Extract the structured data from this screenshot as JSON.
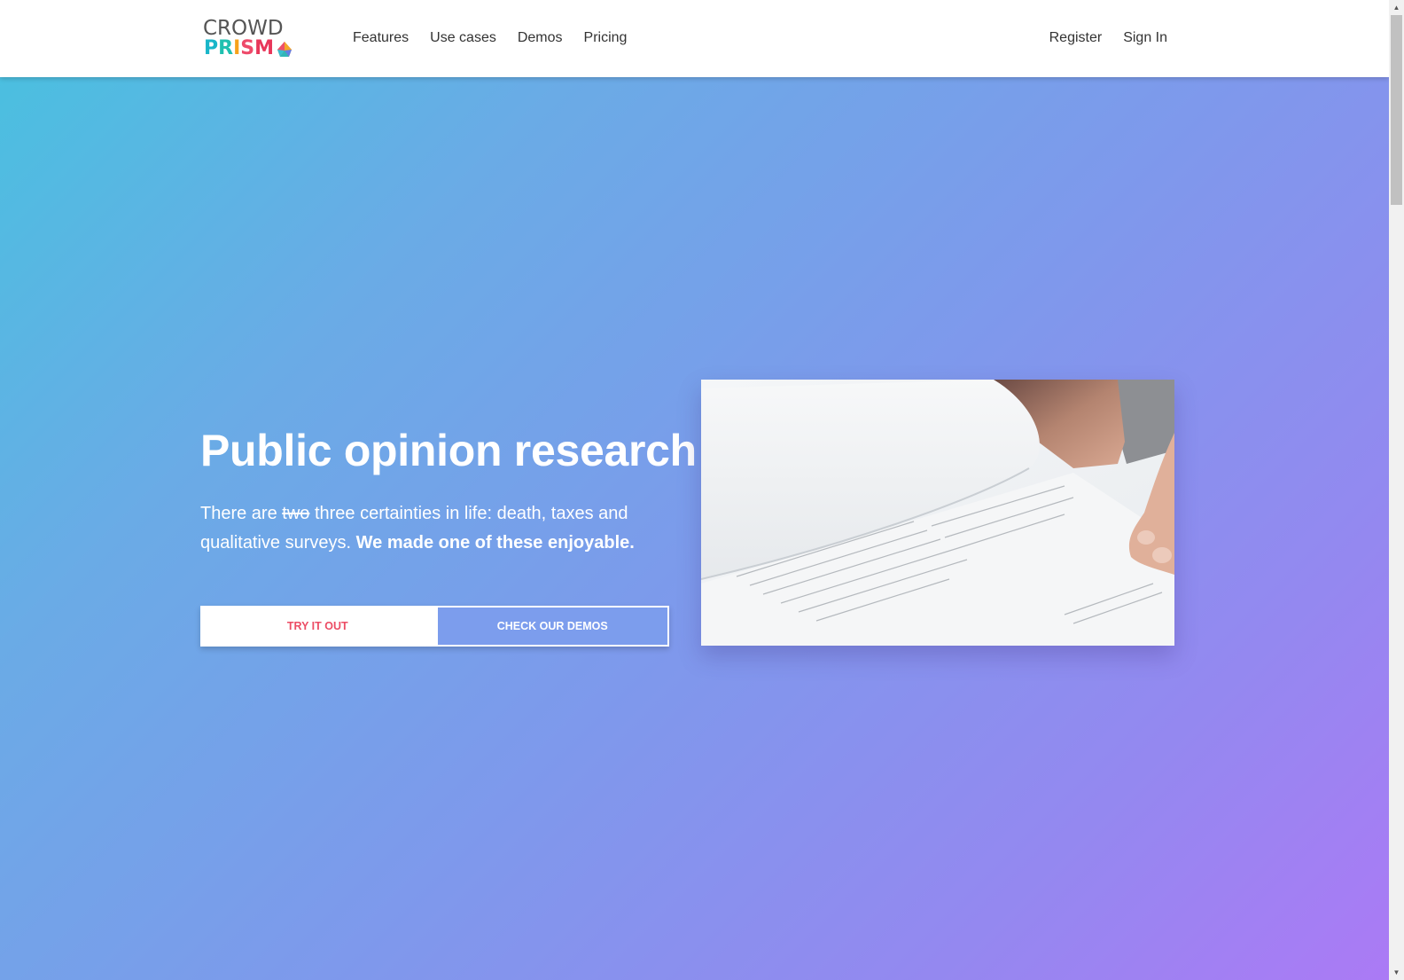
{
  "brand": {
    "line1": "CROWD",
    "line2_letters": [
      "P",
      "R",
      "I",
      "S",
      "M"
    ],
    "logo_icon": "prism-gem-icon",
    "colors": {
      "crowd_text": "#555555",
      "prism_teal": "#19b6c9",
      "prism_orange": "#f7a21b",
      "prism_pink": "#e8375a"
    }
  },
  "nav": {
    "links": [
      {
        "label": "Features"
      },
      {
        "label": "Use cases"
      },
      {
        "label": "Demos"
      },
      {
        "label": "Pricing"
      }
    ],
    "right_links": [
      {
        "label": "Register"
      },
      {
        "label": "Sign In"
      }
    ]
  },
  "hero": {
    "title": "Public opinion research",
    "text_before": "There are ",
    "text_struck": "two",
    "text_middle": " three certainties in life: death, taxes and qualitative surveys. ",
    "text_bold": "We made one of these enjoyable.",
    "buttons": {
      "primary": "TRY IT OUT",
      "secondary": "CHECK OUR DEMOS"
    },
    "image_alt": "Hand turning pages of a printed document",
    "colors": {
      "gradient_start": "#4bbfe0",
      "gradient_end": "#ab7af5",
      "primary_button_text": "#ec4d65",
      "secondary_button_bg": "#7c9ded"
    }
  },
  "scrollbar": {
    "up_icon": "▲",
    "down_icon": "▼",
    "scroll_position": 0
  }
}
